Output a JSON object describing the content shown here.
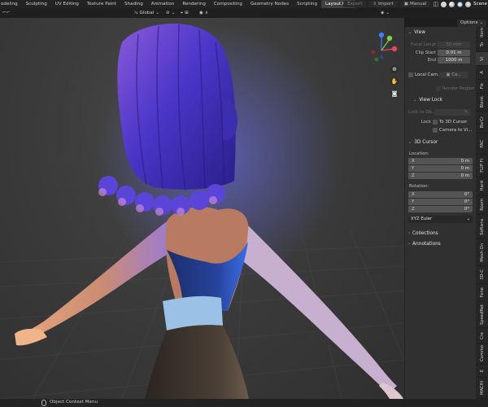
{
  "workspace_tabs": [
    {
      "label": "odeling"
    },
    {
      "label": "Sculpting"
    },
    {
      "label": "UV Editing"
    },
    {
      "label": "Texture Paint"
    },
    {
      "label": "Shading"
    },
    {
      "label": "Animation"
    },
    {
      "label": "Rendering"
    },
    {
      "label": "Compositing"
    },
    {
      "label": "Geometry Nodes"
    },
    {
      "label": "Scripting"
    },
    {
      "label": "Layout.001"
    }
  ],
  "active_tab": "Layout.001",
  "top_right": {
    "export_label": "Export",
    "import_label": "Import",
    "manual_label": "Manual",
    "scene_label": "Scene"
  },
  "header": {
    "orientation": "Global",
    "options_label": "Options"
  },
  "npanel": {
    "view": {
      "title": "View",
      "focal_length_label": "Focal Lengt",
      "focal_length_value": "50 mm",
      "clip_start_label": "Clip Start",
      "clip_start_value": "0.01 m",
      "clip_end_label": "End",
      "clip_end_value": "1000 m",
      "local_camera_label": "Local Cam...",
      "local_camera_value": "Ca...",
      "render_region_label": "Render Region"
    },
    "view_lock": {
      "title": "View Lock",
      "lock_to_obj_label": "Lock to Ob...",
      "lock_label": "Lock",
      "to_3d_cursor_label": "To 3D Cursor",
      "camera_to_view_label": "Camera to Vi..."
    },
    "cursor": {
      "title": "3D Cursor",
      "location_label": "Location:",
      "loc": [
        {
          "axis": "X",
          "value": "0 m"
        },
        {
          "axis": "Y",
          "value": "0 m"
        },
        {
          "axis": "Z",
          "value": "0 m"
        }
      ],
      "rotation_label": "Rotation:",
      "rot": [
        {
          "axis": "X",
          "value": "0°"
        },
        {
          "axis": "Y",
          "value": "0°"
        },
        {
          "axis": "Z",
          "value": "0°"
        }
      ],
      "rotation_mode": "XYZ Euler"
    },
    "collections_title": "Collections",
    "annotations_title": "Annotations"
  },
  "vertical_tabs": [
    {
      "label": "Item"
    },
    {
      "label": "To"
    },
    {
      "label": "Vi"
    },
    {
      "label": "A"
    },
    {
      "label": "Fix"
    },
    {
      "label": "Blenk"
    },
    {
      "label": "BsrCr"
    },
    {
      "label": "FAC"
    },
    {
      "label": "FLIP FI"
    },
    {
      "label": "Hard"
    },
    {
      "label": "Room"
    },
    {
      "label": "Softwra"
    },
    {
      "label": "Mesh On"
    },
    {
      "label": "3D-C"
    },
    {
      "label": "Fene"
    },
    {
      "label": "SpeedRet"
    },
    {
      "label": "Cre"
    },
    {
      "label": "Commo"
    },
    {
      "label": "E"
    },
    {
      "label": "MACHI"
    }
  ],
  "status_bar": {
    "text": "Object Context Menu"
  },
  "colors": {
    "gizmo_x": "#e8475f",
    "gizmo_y": "#7bd045",
    "gizmo_z": "#3b82ec",
    "hair": "#5a3fd6",
    "dress": "#1a2f6b"
  }
}
